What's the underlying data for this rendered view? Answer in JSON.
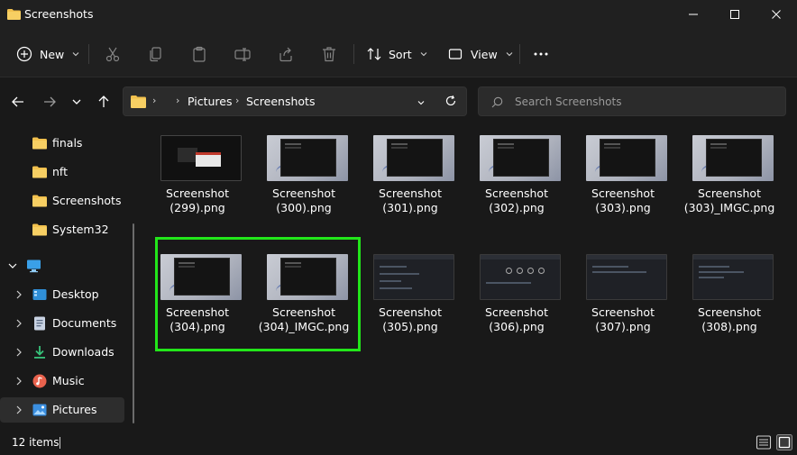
{
  "window": {
    "title": "Screenshots",
    "minimize_icon": "minimize-icon",
    "maximize_icon": "maximize-icon",
    "close_icon": "close-icon"
  },
  "toolbar": {
    "new_label": "New",
    "sort_label": "Sort",
    "view_label": "View",
    "more_icon": "more-icon"
  },
  "address": {
    "crumbs": [
      "Pictures",
      "Screenshots"
    ]
  },
  "search": {
    "placeholder": "Search Screenshots"
  },
  "sidebar": {
    "items": [
      {
        "label": "finals",
        "icon": "folder-icon"
      },
      {
        "label": "nft",
        "icon": "folder-icon"
      },
      {
        "label": "Screenshots",
        "icon": "folder-icon"
      },
      {
        "label": "System32",
        "icon": "folder-icon"
      },
      {
        "label": "",
        "icon": "this-pc-icon"
      },
      {
        "label": "Desktop",
        "icon": "desktop-icon"
      },
      {
        "label": "Documents",
        "icon": "documents-icon"
      },
      {
        "label": "Downloads",
        "icon": "downloads-icon"
      },
      {
        "label": "Music",
        "icon": "music-icon"
      },
      {
        "label": "Pictures",
        "icon": "pictures-icon"
      }
    ]
  },
  "files": [
    {
      "line1": "Screenshot",
      "line2": "(299).png",
      "thumb": "dialog"
    },
    {
      "line1": "Screenshot",
      "line2": "(300).png",
      "thumb": "light"
    },
    {
      "line1": "Screenshot",
      "line2": "(301).png",
      "thumb": "light"
    },
    {
      "line1": "Screenshot",
      "line2": "(302).png",
      "thumb": "light"
    },
    {
      "line1": "Screenshot",
      "line2": "(303).png",
      "thumb": "light"
    },
    {
      "line1": "Screenshot",
      "line2": "(303)_IMGC.png",
      "thumb": "light"
    },
    {
      "line1": "Screenshot",
      "line2": "(304).png",
      "thumb": "light"
    },
    {
      "line1": "Screenshot",
      "line2": "(304)_IMGC.png",
      "thumb": "light"
    },
    {
      "line1": "Screenshot",
      "line2": "(305).png",
      "thumb": "dark"
    },
    {
      "line1": "Screenshot",
      "line2": "(306).png",
      "thumb": "dark"
    },
    {
      "line1": "Screenshot",
      "line2": "(307).png",
      "thumb": "dark"
    },
    {
      "line1": "Screenshot",
      "line2": "(308).png",
      "thumb": "dark"
    }
  ],
  "status": {
    "count": "12 items"
  },
  "colors": {
    "highlight": "#22e61a",
    "folder": "#f2c14e",
    "accent": "#4cc2ff"
  }
}
